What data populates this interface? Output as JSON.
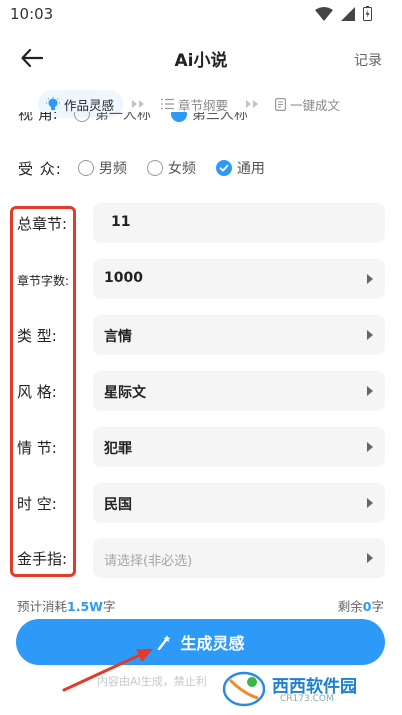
{
  "status": {
    "time": "10:03"
  },
  "header": {
    "title": "Ai小说",
    "record": "记录"
  },
  "steps": [
    {
      "label": "作品灵感",
      "active": true
    },
    {
      "label": "章节纲要",
      "active": false
    },
    {
      "label": "一键成文",
      "active": false
    }
  ],
  "cut_row": {
    "label": "视    角:",
    "opt1": "第一人称",
    "opt2": "第三人称"
  },
  "audience": {
    "label": "受    众:",
    "options": [
      "男频",
      "女频",
      "通用"
    ]
  },
  "fields": {
    "total_chapters": {
      "label": "总章节:",
      "value": "11"
    },
    "chapter_words": {
      "label": "章节字数:",
      "value": "1000"
    },
    "type": {
      "label": "类    型:",
      "value": "言情"
    },
    "style": {
      "label": "风    格:",
      "value": "星际文"
    },
    "plot": {
      "label": "情    节:",
      "value": "犯罪"
    },
    "era": {
      "label": "时    空:",
      "value": "民国"
    },
    "golden_finger": {
      "label": "金手指:",
      "placeholder": "请选择(非必选)"
    }
  },
  "cost": {
    "prefix": "预计消耗",
    "amount": "1.5W",
    "suffix": "字",
    "remain_prefix": "剩余",
    "remain_amount": "0",
    "remain_suffix": "字"
  },
  "generate_button": {
    "label": "生成灵感"
  },
  "disclaimer": "内容由AI生成，禁止利",
  "watermark": {
    "text": "西西软件园",
    "sub": "CR173.COM"
  },
  "colors": {
    "accent": "#2d9af8",
    "highlight": "#e33b2a"
  }
}
